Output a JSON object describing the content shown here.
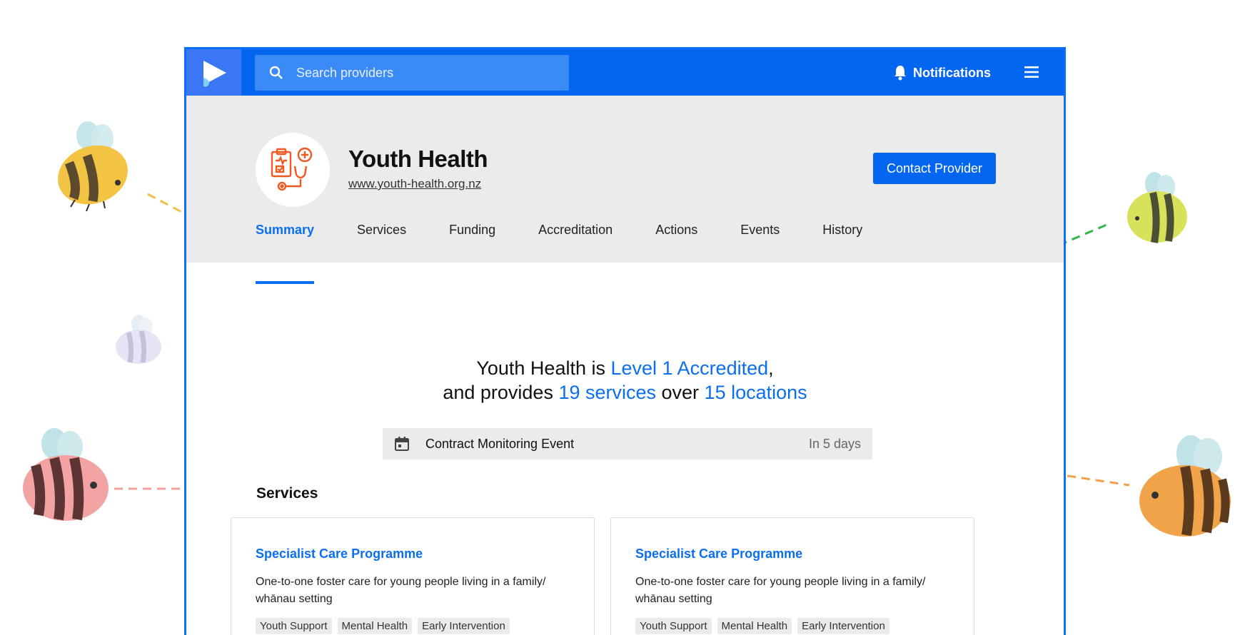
{
  "topbar": {
    "search_placeholder": "Search providers",
    "notifications_label": "Notifications"
  },
  "provider": {
    "name": "Youth Health",
    "url": "www.youth-health.org.nz",
    "contact_label": "Contact Provider"
  },
  "tabs": [
    "Summary",
    "Services",
    "Funding",
    "Accreditation",
    "Actions",
    "Events",
    "History"
  ],
  "summary": {
    "line1_prefix": "Youth Health is ",
    "accreditation": "Level 1 Accredited",
    "line1_suffix": ",",
    "line2_prefix": "and provides ",
    "services_count": "19 services",
    "line2_mid": " over ",
    "locations_count": "15 locations"
  },
  "event": {
    "title": "Contract Monitoring Event",
    "when": "In 5 days"
  },
  "services": {
    "heading": "Services",
    "cards": [
      {
        "title": "Specialist Care Programme",
        "desc": "One-to-one foster care for young people living in a family/ whānau setting",
        "tags": [
          "Youth Support",
          "Mental Health",
          "Early Intervention"
        ]
      },
      {
        "title": "Specialist Care Programme",
        "desc": "One-to-one foster care for young people living in a family/ whānau setting",
        "tags": [
          "Youth Support",
          "Mental Health",
          "Early Intervention"
        ]
      }
    ]
  },
  "colors": {
    "accent": "#0b6ef0",
    "topbar": "#0366f0",
    "header_bg": "#ebebeb"
  }
}
